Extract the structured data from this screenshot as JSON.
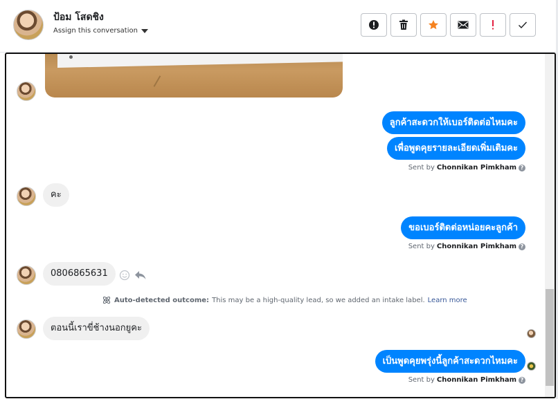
{
  "header": {
    "contact_name": "ป้อม โสดชิง",
    "assign_label": "Assign this conversation",
    "toolbar": [
      {
        "name": "alert-button",
        "icon": "exclamation-circle-icon"
      },
      {
        "name": "delete-button",
        "icon": "trash-icon"
      },
      {
        "name": "star-button",
        "icon": "star-icon",
        "color": "#f5821f"
      },
      {
        "name": "email-button",
        "icon": "envelope-icon"
      },
      {
        "name": "priority-button",
        "icon": "exclamation-icon",
        "color": "#e41e3f"
      },
      {
        "name": "done-button",
        "icon": "check-icon"
      }
    ]
  },
  "messages": {
    "out1": "ลูกค้าสะดวกให้เบอร์ติดต่อไหมคะ",
    "out2": "เพื่อพูดคุยรายละเอียดเพิ่มเติมคะ",
    "in1": "คะ",
    "out3": "ขอเบอร์ติดต่อหน่อยคะลูกค้า",
    "in2": "0806865631",
    "in3": "ตอนนี้เราขี่ช้างนอกยูคะ",
    "out4": "เป็นพูดคุยพรุ่งนี้ลูกค้าสะดวกไหมคะ"
  },
  "sent_by": {
    "prefix": "Sent by",
    "name": "Chonnikan Pimkham",
    "help": "?"
  },
  "outcome": {
    "label": "Auto-detected outcome:",
    "text": "This may be a high-quality lead, so we added an intake label.",
    "link": "Learn more"
  },
  "colors": {
    "outgoing_bubble": "#0084ff",
    "incoming_bubble": "#f0f0f0",
    "link": "#385898"
  }
}
